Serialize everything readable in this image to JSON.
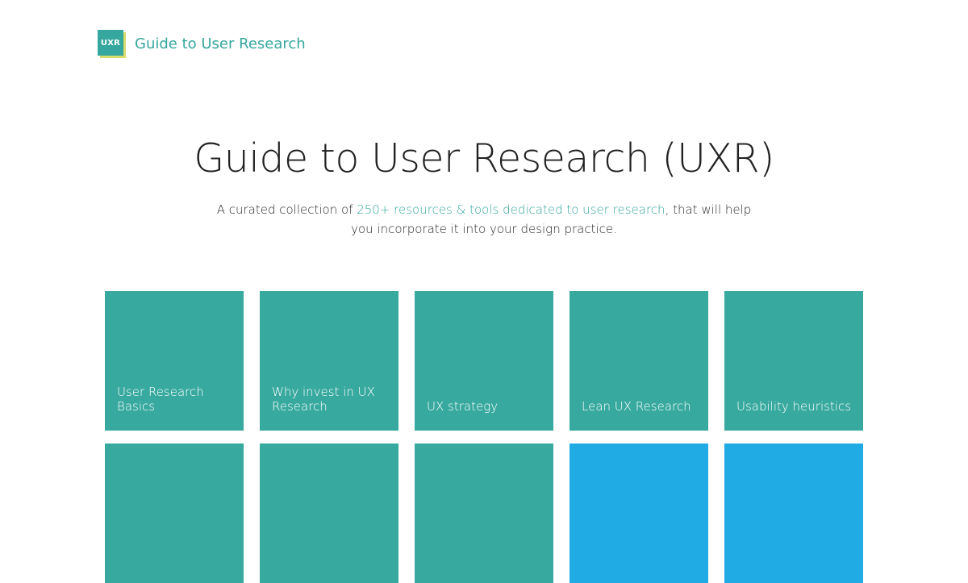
{
  "header": {
    "logo_text": "UXR",
    "title": "Guide to User Research"
  },
  "hero": {
    "heading": "Guide to User Research (UXR)",
    "intro_before": "A curated collection of ",
    "intro_link": "250+ resources & tools dedicated to user research",
    "intro_after": ",  that will help you incorporate it into your design practice."
  },
  "colors": {
    "brand_teal": "#35a79e",
    "accent_blue": "#21abe5",
    "logo_shadow": "#d8dc6a"
  },
  "tiles": [
    {
      "label": "User Research Basics",
      "color": "#37a99f"
    },
    {
      "label": "Why invest in UX Research",
      "color": "#37a99f"
    },
    {
      "label": "UX strategy",
      "color": "#37a99f"
    },
    {
      "label": "Lean UX Research",
      "color": "#37a99f"
    },
    {
      "label": "Usability heuristics",
      "color": "#37a99f"
    },
    {
      "label": "",
      "color": "#37a99f"
    },
    {
      "label": "",
      "color": "#37a99f"
    },
    {
      "label": "",
      "color": "#37a99f"
    },
    {
      "label": "",
      "color": "#21abe5"
    },
    {
      "label": "",
      "color": "#21abe5"
    }
  ]
}
